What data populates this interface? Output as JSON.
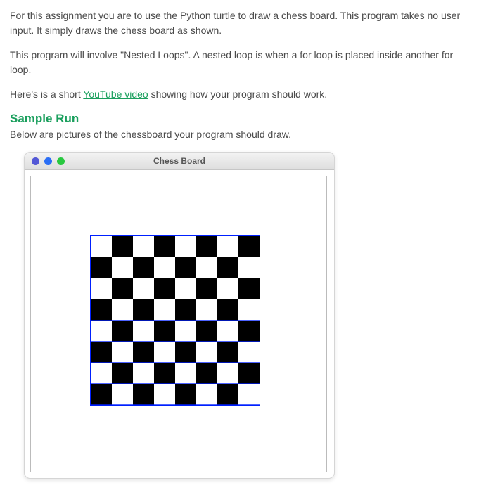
{
  "para1": "For this assignment you are to use the Python turtle to draw a chess board. This program takes no user input. It simply draws the chess board as shown.",
  "para2_a": "This program will involve \"Nested Loops\". A nested loop is when a for loop is placed inside another for loop.",
  "para3_a": "Here's is a short ",
  "para3_link": "YouTube video",
  "para3_b": " showing how your program should work.",
  "sample_run_heading": "Sample Run",
  "sample_run_caption": "Below are pictures of the chessboard your program should draw.",
  "window_title": "Chess Board",
  "board": {
    "size": 8,
    "dark_color": "#000000",
    "light_color": "#ffffff",
    "outline_color": "#0020ff"
  }
}
